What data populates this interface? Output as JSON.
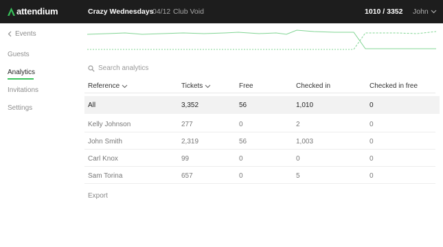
{
  "app": {
    "logo_text": "attendium"
  },
  "header": {
    "event_title": "Crazy Wednesdays",
    "event_date": "04/12",
    "event_venue": "Club Void",
    "counter": "1010 / 3352",
    "user_name": "John"
  },
  "sidebar": {
    "back_label": "Events",
    "items": [
      {
        "label": "Guests",
        "active": false
      },
      {
        "label": "Analytics",
        "active": true
      },
      {
        "label": "Invitations",
        "active": false
      },
      {
        "label": "Settings",
        "active": false
      }
    ]
  },
  "search": {
    "placeholder": "Search analytics"
  },
  "table": {
    "columns": [
      "Reference",
      "Tickets",
      "Free",
      "Checked in",
      "Checked in free"
    ],
    "rows": [
      [
        "All",
        "3,352",
        "56",
        "1,010",
        "0"
      ],
      [
        "Kelly Johnson",
        "277",
        "0",
        "2",
        "0"
      ],
      [
        "John Smith",
        "2,319",
        "56",
        "1,003",
        "0"
      ],
      [
        "Carl Knox",
        "99",
        "0",
        "0",
        "0"
      ],
      [
        "Sam Torina",
        "657",
        "0",
        "5",
        "0"
      ]
    ]
  },
  "footer": {
    "export_label": "Export"
  },
  "colors": {
    "accent": "#37c25a",
    "topbar": "#1d1d1d",
    "highlight_row": "#f2f2f2"
  }
}
